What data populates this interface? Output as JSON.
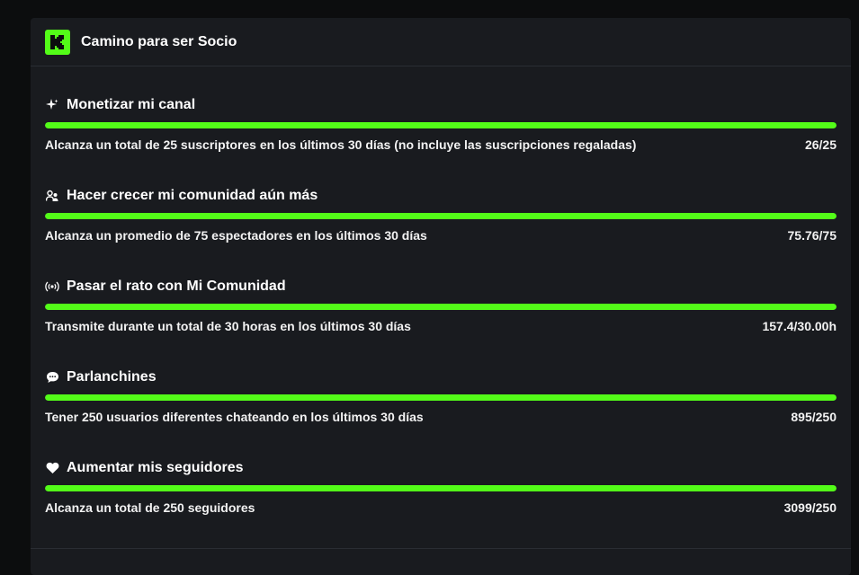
{
  "header": {
    "title": "Camino para ser Socio",
    "logo_icon": "kick-logo-icon"
  },
  "colors": {
    "accent": "#53fc18",
    "card_bg": "#191b1f",
    "page_bg": "#0c0d0e"
  },
  "goals": [
    {
      "icon": "sparkle-icon",
      "title": "Monetizar mi canal",
      "description": "Alcanza un total de 25 suscriptores en los últimos 30 días (no incluye las suscripciones regaladas)",
      "value": "26/25",
      "progress": 1.0
    },
    {
      "icon": "users-icon",
      "title": "Hacer crecer mi comunidad aún más",
      "description": "Alcanza un promedio de 75 espectadores en los últimos 30 días",
      "value": "75.76/75",
      "progress": 1.0
    },
    {
      "icon": "broadcast-icon",
      "title": "Pasar el rato con Mi Comunidad",
      "description": "Transmite durante un total de 30 horas en los últimos 30 días",
      "value": "157.4/30.00h",
      "progress": 1.0
    },
    {
      "icon": "chat-bubble-icon",
      "title": "Parlanchines",
      "description": "Tener 250 usuarios diferentes chateando en los últimos 30 días",
      "value": "895/250",
      "progress": 1.0
    },
    {
      "icon": "heart-icon",
      "title": "Aumentar mis seguidores",
      "description": "Alcanza un total de 250 seguidores",
      "value": "3099/250",
      "progress": 1.0
    }
  ]
}
